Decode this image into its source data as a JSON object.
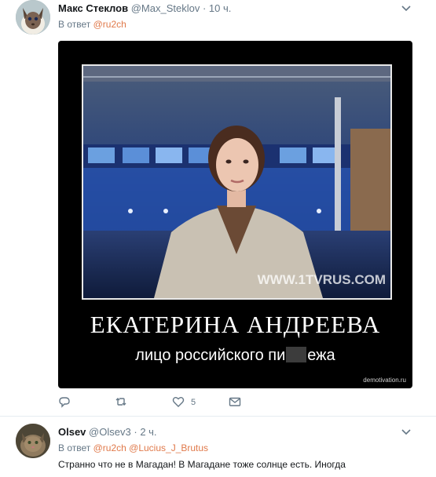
{
  "tweets": [
    {
      "name": "Макс Стеклов",
      "handle": "@Max_Steklov",
      "separator": "·",
      "time": "10 ч.",
      "reply_prefix": "В ответ",
      "reply_mentions": [
        "@ru2ch"
      ],
      "media": {
        "title": "ЕКАТЕРИНА АНДРЕЕВА",
        "subtitle_before": "лицо российского пи",
        "subtitle_after": "ежа",
        "photo_watermark": "WWW.1TVRUS.COM",
        "site_watermark": "demotivation.ru"
      },
      "actions": {
        "reply_icon": "reply-icon",
        "retweet_icon": "retweet-icon",
        "like_icon": "heart-icon",
        "like_count": "5",
        "message_icon": "envelope-icon"
      }
    },
    {
      "name": "Olsev",
      "handle": "@Olsev3",
      "separator": "·",
      "time": "2 ч.",
      "reply_prefix": "В ответ",
      "reply_mentions": [
        "@ru2ch",
        "@Lucius_J_Brutus"
      ],
      "text": "Странно что не в Магадан! В Магадане тоже солнце есть. Иногда"
    }
  ],
  "colors": {
    "mention": "#e0794a",
    "secondary_text": "#657786",
    "divider": "#e6ecf0"
  }
}
